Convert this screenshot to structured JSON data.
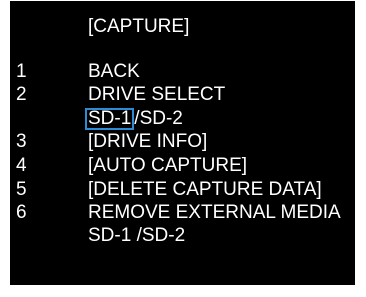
{
  "menu": {
    "title": "[CAPTURE]",
    "accent_color": "#2d8bd6",
    "items": [
      {
        "number": "1",
        "label": "BACK"
      },
      {
        "number": "2",
        "label": "DRIVE SELECT",
        "options": {
          "selected": "SD-1",
          "rest": "/SD-2"
        }
      },
      {
        "number": "3",
        "label": "[DRIVE INFO]"
      },
      {
        "number": "4",
        "label": "[AUTO CAPTURE]"
      },
      {
        "number": "5",
        "label": "[DELETE CAPTURE DATA]"
      },
      {
        "number": "6",
        "label": "REMOVE EXTERNAL MEDIA",
        "options": {
          "value": "SD-1 /SD-2"
        }
      }
    ]
  }
}
